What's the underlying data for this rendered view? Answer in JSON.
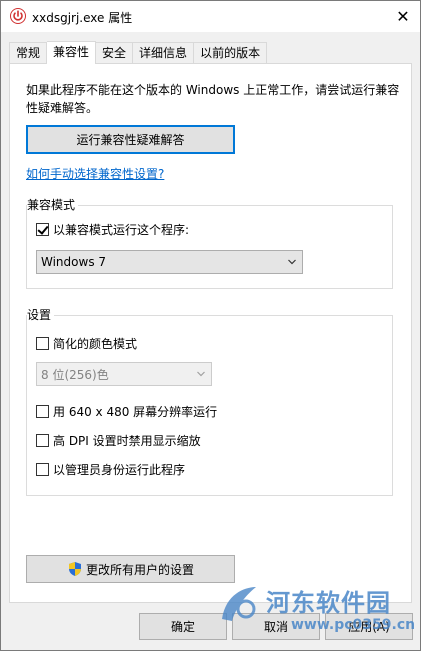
{
  "window": {
    "title": "xxdsgjrj.exe 属性",
    "close_label": "✕"
  },
  "tabs": [
    {
      "label": "常规",
      "active": false
    },
    {
      "label": "兼容性",
      "active": true
    },
    {
      "label": "安全",
      "active": false
    },
    {
      "label": "详细信息",
      "active": false
    },
    {
      "label": "以前的版本",
      "active": false
    }
  ],
  "compat": {
    "intro": "如果此程序不能在这个版本的 Windows 上正常工作，请尝试运行兼容性疑难解答。",
    "troubleshoot_button": "运行兼容性疑难解答",
    "manual_link": "如何手动选择兼容性设置?",
    "mode_group": {
      "title": "兼容模式",
      "checkbox_label": "以兼容模式运行这个程序:",
      "checked": true,
      "os_value": "Windows 7"
    },
    "settings_group": {
      "title": "设置",
      "reduced_color": {
        "label": "简化的颜色模式",
        "checked": false
      },
      "color_value": "8 位(256)色",
      "res_640": {
        "label": "用 640 x 480 屏幕分辨率运行",
        "checked": false
      },
      "high_dpi": {
        "label": "高 DPI 设置时禁用显示缩放",
        "checked": false
      },
      "run_admin": {
        "label": "以管理员身份运行此程序",
        "checked": false
      }
    },
    "all_users_button": "更改所有用户的设置"
  },
  "footer": {
    "ok": "确定",
    "cancel": "取消",
    "apply": "应用(A)"
  },
  "watermark": {
    "text": "河东软件园",
    "url": "www.pc0359.cn"
  },
  "colors": {
    "accent": "#0078d7",
    "link": "#0066cc",
    "watermark": "#4a87c8"
  }
}
